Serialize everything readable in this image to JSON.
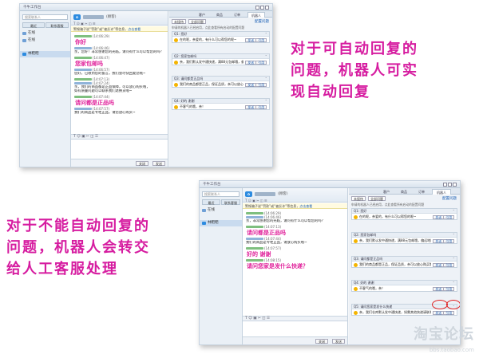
{
  "window": {
    "title": "千牛工作台"
  },
  "search": {
    "placeholder": "搜索联系人"
  },
  "left_tabs": [
    "最近",
    "联系客服"
  ],
  "contacts": [
    {
      "label": "在线"
    },
    {
      "label": "在线"
    },
    {
      "label": "林粑粑"
    }
  ],
  "chat": {
    "role": "(顾客)",
    "notice_text": "警惕骗子说“罚款”或“被反诈”等信息，",
    "notice_link": "点击查看",
    "tool_icons": "T ☺ ▣ ✂ ◫ ☰",
    "send_label": "发送",
    "close_label": "关闭"
  },
  "top_chat": {
    "messages": [
      {
        "time": "(14:06:29)",
        "kind": "customer"
      },
      {
        "time": "(14:06:46)",
        "kind": "robot",
        "lines": [
          "亲，您好！非常感谢您的光临，请问有什么可以帮您的吗？"
        ]
      },
      {
        "time": "(14:06:47)",
        "kind": "customer"
      },
      {
        "time": "(14:06:57)",
        "kind": "robot",
        "lines": [
          "您好，已收到您的留言，我们会尽快回复您哦~"
        ]
      },
      {
        "time": "(14:07:13)",
        "kind": "customer"
      },
      {
        "time": "(14:07:24)",
        "kind": "robot",
        "lines": [
          "亲，我们的商品都是正品保障，可以放心购买哦，",
          "如有质量问题可以联系我们退换货哦~"
        ]
      },
      {
        "time": "(14:07:44)",
        "kind": "customer"
      },
      {
        "time": "(14:07:57)",
        "kind": "robot",
        "lines": [
          "我们的商品是专柜正品，请您放心购买~"
        ]
      }
    ],
    "big_lines": [
      "你好",
      "您家包邮吗",
      "请问都是正品吗"
    ]
  },
  "bottom_chat": {
    "messages": [
      {
        "time": "(14:06:29)",
        "kind": "customer"
      },
      {
        "time": "(14:06:46)",
        "kind": "robot",
        "lines": [
          "亲，非常感谢您的光临，请问有什么可以帮您的吗？"
        ]
      },
      {
        "time": "(14:07:13)",
        "kind": "customer"
      },
      {
        "time": "(14:07:44)",
        "kind": "robot",
        "lines": [
          "我们的商品是专柜正品，请放心购买哦~"
        ]
      },
      {
        "time": "(14:07:57)",
        "kind": "customer"
      },
      {
        "time": "(14:08:15)",
        "kind": "customer"
      }
    ],
    "big_lines": [
      "请问都是正品吗",
      "好的  谢谢",
      "请问您家是发什么快递？"
    ]
  },
  "right_panel": {
    "tabs": [
      "客户",
      "商品",
      "订单",
      "机器人"
    ],
    "sub_buttons": [
      "未接待",
      "全部问题"
    ],
    "config_link": "配置问题",
    "hint": "申请的机器人已经启用，点此查看所有启动的配置问题",
    "hint_link": "点此查看",
    "send_label": "发送",
    "ref_label": "引用"
  },
  "top_questions": [
    {
      "q": "Q1: 您好",
      "a": "在的呢，亲爱的，有什么可以帮您的呢~"
    },
    {
      "q": "Q2: 您家包邮吗",
      "a": "亲，我们默认发中通快递，满88元包邮哦，偏远地区除外，具体可以咨询客服哦~"
    },
    {
      "q": "Q3: 请问都是正品吗",
      "a": "我们的商品都是正品，保证品质，亲可以放心购买哦~"
    },
    {
      "q": "Q4: 好的 谢谢",
      "a": "不客气的哦，亲！"
    }
  ],
  "bottom_questions": [
    {
      "q": "Q1: 您好",
      "a": "在的呢，亲爱的，有什么可以帮您的呢~"
    },
    {
      "q": "Q2: 您家包邮吗",
      "a": "亲，我们默认发中通快递，满88元包邮哦，偏远地区除外，具体可以咨询客服哦~"
    },
    {
      "q": "Q3: 请问都是正品吗",
      "a": "我们的商品都是正品，保证品质，亲可以放心购买哦~"
    },
    {
      "q": "Q4: 好的 谢谢",
      "a": "不客气的哦，亲！"
    },
    {
      "q": "Q5: 请问您家是发什么快递",
      "a": "亲，我们仓库默认发中通快递，如需其他快递请联系客服哦~"
    }
  ],
  "captions": {
    "top": [
      "对于可自动回复的",
      "问题，机器人可实",
      "现自动回复"
    ],
    "bottom": [
      "对于不能自动回复的",
      "问题，机器人会转交",
      "给人工客服处理"
    ]
  },
  "watermark": {
    "text": "淘宝论坛",
    "url": "bbs.taobao.com"
  }
}
